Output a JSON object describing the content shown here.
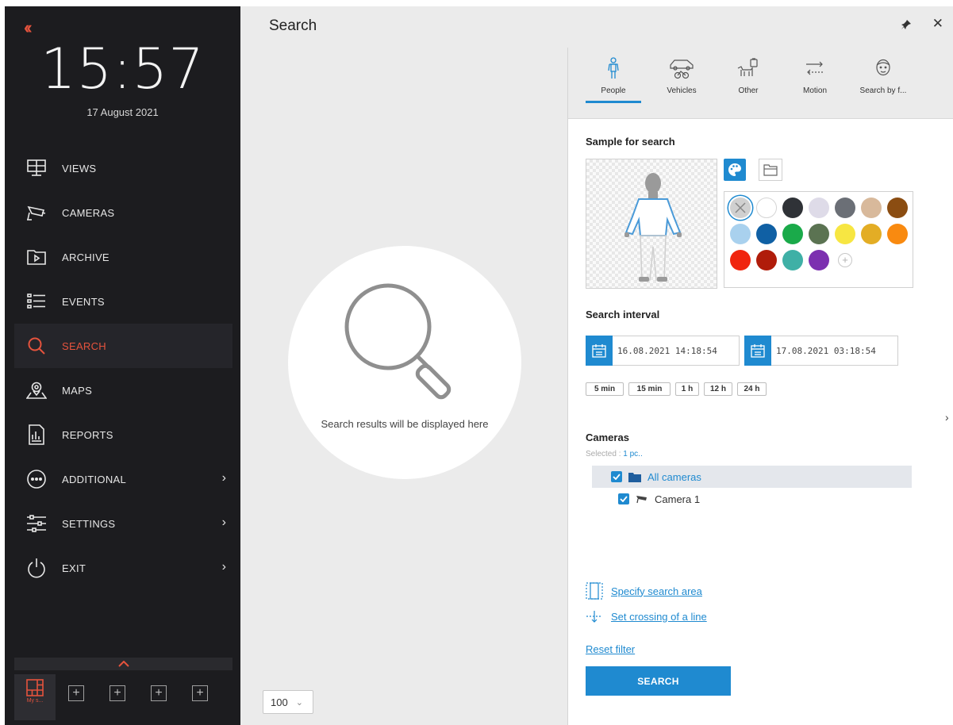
{
  "sidebar": {
    "time": "15:57",
    "date": "17 August 2021",
    "items": [
      {
        "label": "VIEWS",
        "icon": "views-icon"
      },
      {
        "label": "CAMERAS",
        "icon": "cameras-icon"
      },
      {
        "label": "ARCHIVE",
        "icon": "archive-icon"
      },
      {
        "label": "EVENTS",
        "icon": "events-icon"
      },
      {
        "label": "SEARCH",
        "icon": "search-icon"
      },
      {
        "label": "MAPS",
        "icon": "maps-icon"
      },
      {
        "label": "REPORTS",
        "icon": "reports-icon"
      },
      {
        "label": "ADDITIONAL",
        "icon": "additional-icon"
      },
      {
        "label": "SETTINGS",
        "icon": "settings-icon"
      },
      {
        "label": "EXIT",
        "icon": "exit-icon"
      }
    ],
    "active_item": "SEARCH",
    "layout_label": "My s..."
  },
  "header": {
    "title": "Search"
  },
  "results": {
    "placeholder": "Search results will be displayed here",
    "zoom": "100"
  },
  "tabs": [
    {
      "label": "People",
      "icon": "person-icon"
    },
    {
      "label": "Vehicles",
      "icon": "vehicles-icon"
    },
    {
      "label": "Other",
      "icon": "other-icon"
    },
    {
      "label": "Motion",
      "icon": "motion-icon"
    },
    {
      "label": "Search by f...",
      "icon": "face-icon"
    }
  ],
  "active_tab": "People",
  "sample": {
    "title": "Sample for search",
    "colors": [
      "#d0d0d0",
      "#ffffff",
      "#2f3237",
      "#dedbe8",
      "#6b6f76",
      "#d8b99b",
      "#8b4d12",
      "#a9d1ee",
      "#1060a4",
      "#1aaa4a",
      "#5b7352",
      "#f7e642",
      "#e3ad25",
      "#f98a10",
      "#f0250f",
      "#b01c0a",
      "#3fb0a6",
      "#7c30b0"
    ]
  },
  "interval": {
    "title": "Search interval",
    "from": "16.08.2021  14:18:54",
    "to": "17.08.2021  03:18:54",
    "presets": [
      "5 min",
      "15 min",
      "1 h",
      "12 h",
      "24 h"
    ]
  },
  "cameras": {
    "title": "Cameras",
    "selected_label": "Selected :",
    "selected_value": "1 pc..",
    "items": [
      {
        "label": "All cameras"
      },
      {
        "label": "Camera 1"
      }
    ]
  },
  "actions": {
    "specify_area": "Specify search area",
    "set_crossing": "Set crossing of a line",
    "reset": "Reset filter",
    "search": "SEARCH"
  },
  "colors": {
    "accent": "#1f8ad0",
    "sidebar_accent": "#e5533d",
    "sidebar_bg": "#1c1c1f"
  }
}
